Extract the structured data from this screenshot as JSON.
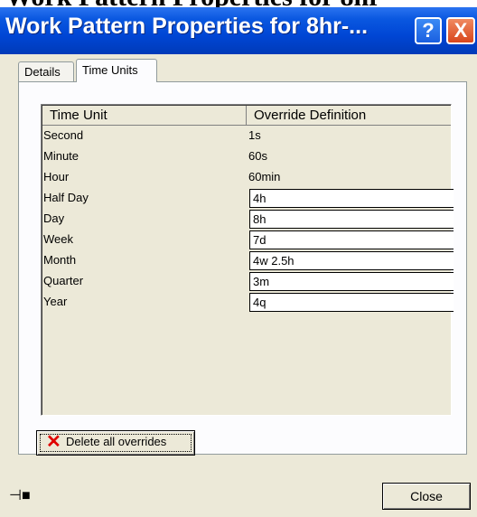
{
  "window": {
    "obscured_top_text": "Work Pattern Properties for 8hr",
    "title": "Work Pattern Properties for 8hr-...",
    "help_label": "?",
    "close_label": "X"
  },
  "tabs": [
    {
      "label": "Details"
    },
    {
      "label": "Time Units",
      "active": true
    }
  ],
  "grid": {
    "columns": [
      "Time Unit",
      "Override Definition"
    ],
    "rows": [
      {
        "unit": "Second",
        "definition": "1s",
        "editable": false
      },
      {
        "unit": "Minute",
        "definition": "60s",
        "editable": false
      },
      {
        "unit": "Hour",
        "definition": "60min",
        "editable": false
      },
      {
        "unit": "Half Day",
        "definition": "4h",
        "editable": true
      },
      {
        "unit": "Day",
        "definition": "8h",
        "editable": true
      },
      {
        "unit": "Week",
        "definition": "7d",
        "editable": true
      },
      {
        "unit": "Month",
        "definition": "4w 2.5h",
        "editable": true
      },
      {
        "unit": "Quarter",
        "definition": "3m",
        "editable": true
      },
      {
        "unit": "Year",
        "definition": "4q",
        "editable": true
      }
    ]
  },
  "actions": {
    "delete_label": "Delete all overrides",
    "close_label": "Close"
  },
  "icons": {
    "delete": "red-x-icon",
    "pin": "pushpin-icon"
  }
}
